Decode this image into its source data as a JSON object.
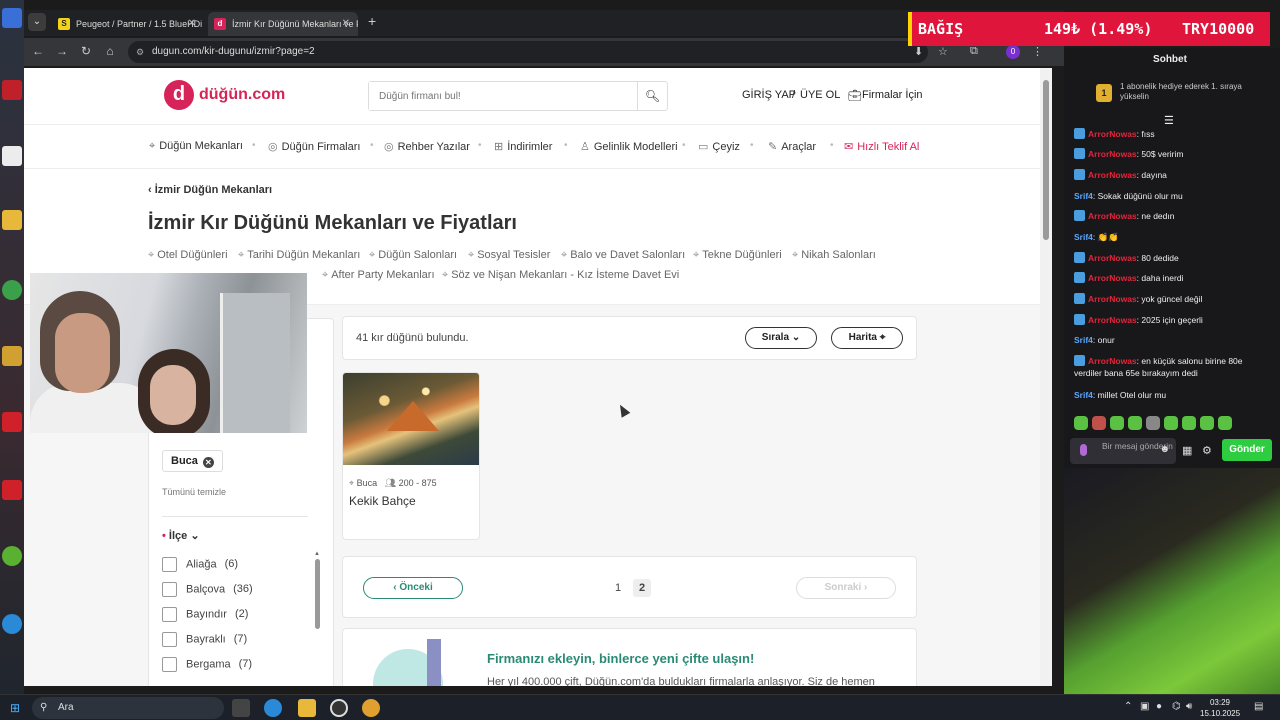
{
  "browser": {
    "tabs": [
      {
        "title": "Peugeot / Partner / 1.5 BlueHDi",
        "favicon": "S"
      },
      {
        "title": "İzmir Kır Düğünü Mekanları ve Fiyatları",
        "favicon": "d"
      }
    ],
    "url": "dugun.com/kir-dugunu/izmir?page=2"
  },
  "donation_bar": {
    "label": "BAĞIŞ",
    "amount": "149₺ (1.49%)",
    "goal": "TRY10000"
  },
  "site": {
    "logo_text": "düğün.com",
    "search_placeholder": "Düğün firmanı bul!",
    "login": "GİRİŞ YAP",
    "divider": "/",
    "register": "ÜYE OL",
    "for_business": "Firmalar İçin",
    "nav": [
      "Düğün Mekanları",
      "Düğün Firmaları",
      "Rehber Yazılar",
      "İndirimler",
      "Gelinlik Modelleri",
      "Çeyiz",
      "Araçlar",
      "Hızlı Teklif Al"
    ],
    "breadcrumb": "İzmir Düğün Mekanları",
    "title": "İzmir Kır Düğünü Mekanları ve Fiyatları",
    "chips_row1": [
      "Otel Düğünleri",
      "Tarihi Düğün Mekanları",
      "Düğün Salonları",
      "Sosyal Tesisler",
      "Balo ve Davet Salonları",
      "Tekne Düğünleri",
      "Nikah Salonları"
    ],
    "chips_row2": [
      "After Party Mekanları",
      "Söz ve Nişan Mekanları - Kız İsteme Davet Evi"
    ]
  },
  "filters": {
    "active_tag": "Buca",
    "clear_all": "Tümünü temizle",
    "district_label": "İlçe",
    "districts": [
      {
        "name": "Aliağa",
        "count": "(6)"
      },
      {
        "name": "Balçova",
        "count": "(36)"
      },
      {
        "name": "Bayındır",
        "count": "(2)"
      },
      {
        "name": "Bayraklı",
        "count": "(7)"
      },
      {
        "name": "Bergama",
        "count": "(7)"
      }
    ]
  },
  "results": {
    "count_text": "41 kır düğünü bulundu.",
    "sort_label": "Sırala",
    "map_label": "Harita"
  },
  "card": {
    "location": "Buca",
    "capacity": "200 - 875",
    "name": "Kekik Bahçe"
  },
  "pagination": {
    "prev": "Önceki",
    "pages": [
      "1",
      "2"
    ],
    "current": "2",
    "next": "Sonraki"
  },
  "promo": {
    "title": "Firmanızı ekleyin, binlerce yeni çifte ulaşın!",
    "text": "Her yıl 400.000 çift, Düğün.com'da buldukları firmalarla anlaşıyor. Siz de hemen"
  },
  "chat": {
    "title": "Sohbet",
    "sub_notice": "1 abonelik hediye ederek 1. sıraya yükselin",
    "medal": "1",
    "messages": [
      {
        "user": "ArrorNowas",
        "text": "fıss",
        "color": "#e5243b"
      },
      {
        "user": "ArrorNowas",
        "text": "50$ veririm",
        "color": "#e5243b"
      },
      {
        "user": "ArrorNowas",
        "text": "dayına",
        "color": "#e5243b"
      },
      {
        "user": "Srif4",
        "text": "Sokak düğünü olur mu",
        "color": "#5aa7ff"
      },
      {
        "user": "ArrorNowas",
        "text": "ne dedın",
        "color": "#e5243b"
      },
      {
        "user": "Srif4",
        "text": "👏👏",
        "color": "#5aa7ff"
      },
      {
        "user": "ArrorNowas",
        "text": "80 dedide",
        "color": "#e5243b"
      },
      {
        "user": "ArrorNowas",
        "text": "daha inerdi",
        "color": "#e5243b"
      },
      {
        "user": "ArrorNowas",
        "text": "yok güncel değil",
        "color": "#e5243b"
      },
      {
        "user": "ArrorNowas",
        "text": "2025 için geçerli",
        "color": "#e5243b"
      },
      {
        "user": "Srif4",
        "text": "onur",
        "color": "#5aa7ff"
      },
      {
        "user": "ArrorNowas",
        "text": "en küçük salonu birine 80e verdiler bana 65e bırakayım dedi",
        "color": "#e5243b"
      },
      {
        "user": "Srif4",
        "text": "millet Otel olur mu",
        "color": "#5aa7ff"
      }
    ],
    "input_placeholder": "Bir mesaj gönderin",
    "send": "Gönder"
  },
  "taskbar": {
    "search": "Ara",
    "time": "03:29",
    "date": "15.10.2025"
  },
  "colors": {
    "brand": "#d6245a",
    "teal": "#2a8a76",
    "donation": "#e0153c",
    "send": "#2ecc40"
  }
}
